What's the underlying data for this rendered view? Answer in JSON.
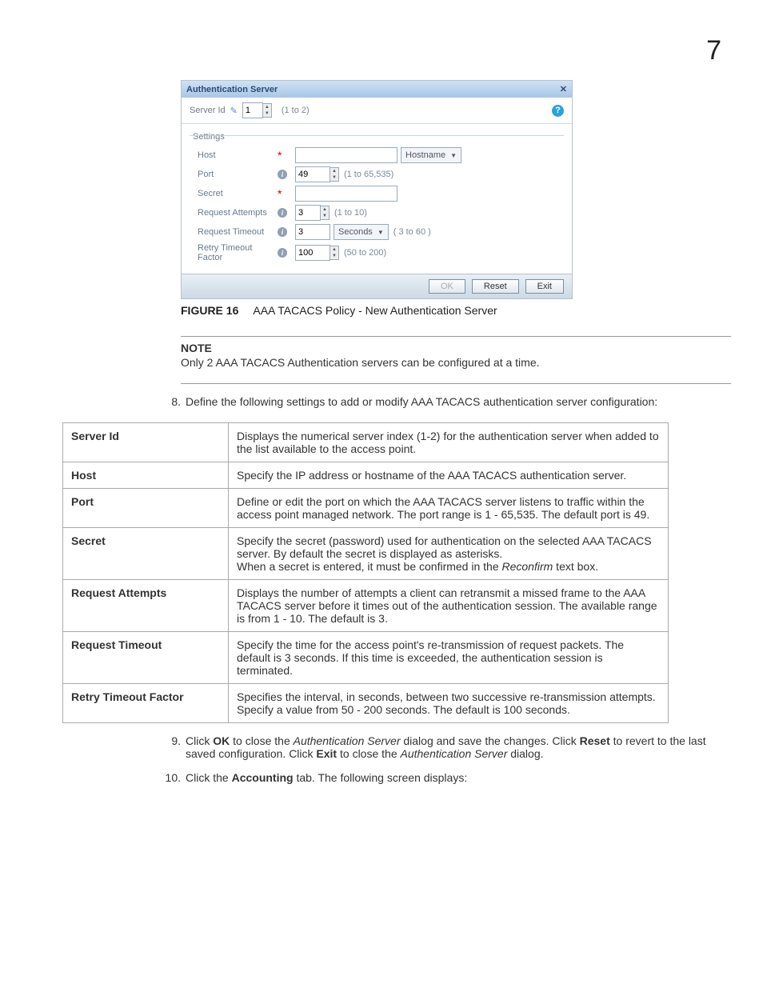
{
  "page_number": "7",
  "dialog": {
    "title": "Authentication Server",
    "server_id_label": "Server Id",
    "server_id_value": "1",
    "server_id_hint": "(1 to 2)",
    "settings_legend": "Settings",
    "fields": {
      "host": {
        "label": "Host",
        "value": "",
        "dropdown": "Hostname"
      },
      "port": {
        "label": "Port",
        "value": "49",
        "hint": "(1 to 65,535)"
      },
      "secret": {
        "label": "Secret",
        "value": ""
      },
      "attempts": {
        "label": "Request Attempts",
        "value": "3",
        "hint": "(1 to 10)"
      },
      "timeout": {
        "label": "Request Timeout",
        "value": "3",
        "unit": "Seconds",
        "hint": "( 3 to 60 )"
      },
      "retry": {
        "label": "Retry Timeout Factor",
        "value": "100",
        "hint": "(50 to 200)"
      }
    },
    "buttons": {
      "ok": "OK",
      "reset": "Reset",
      "exit": "Exit"
    }
  },
  "figure": {
    "label": "FIGURE 16",
    "caption": "AAA TACACS Policy - New Authentication Server"
  },
  "note": {
    "head": "NOTE",
    "text": "Only 2 AAA TACACS Authentication servers can be configured at a time."
  },
  "step8": {
    "num": "8.",
    "text": "Define the following settings to add or modify AAA TACACS authentication server configuration:"
  },
  "table": [
    {
      "k": "Server Id",
      "v": "Displays the numerical server index (1-2) for the authentication server when added to the list available to the access point."
    },
    {
      "k": "Host",
      "v": "Specify the IP address or hostname of the AAA TACACS authentication server."
    },
    {
      "k": "Port",
      "v": "Define or edit the port on which the AAA TACACS server listens to traffic within the access point managed network. The port range is 1 - 65,535. The default port is 49."
    },
    {
      "k": "Secret",
      "v1": "Specify the secret (password) used for authentication on the selected AAA TACACS server. By default the secret is displayed as asterisks.",
      "v2a": "When a secret is entered, it must be confirmed in the ",
      "v2i": "Reconfirm",
      "v2b": " text box."
    },
    {
      "k": "Request Attempts",
      "v": "Displays the number of attempts a client can retransmit a missed frame to the AAA TACACS server before it times out of the authentication session. The available range is from 1 - 10. The default is 3."
    },
    {
      "k": "Request Timeout",
      "v": "Specify the time for the access point's re-transmission of request packets. The default is 3 seconds. If this time is exceeded, the authentication session is terminated."
    },
    {
      "k": "Retry Timeout Factor",
      "v": "Specifies the interval, in seconds, between two successive re-transmission attempts. Specify a value from 50 - 200 seconds. The default is 100 seconds."
    }
  ],
  "step9": {
    "num": "9.",
    "p1": "Click ",
    "ok": "OK",
    "p2": " to close the ",
    "i1": "Authentication Server",
    "p3": " dialog and save the changes. Click ",
    "reset": "Reset",
    "p4": " to revert to the last saved configuration. Click ",
    "exit": "Exit",
    "p5": " to close the ",
    "i2": "Authentication Server",
    "p6": " dialog."
  },
  "step10": {
    "num": "10.",
    "p1": "Click the ",
    "acct": "Accounting",
    "p2": " tab. The following screen displays:"
  }
}
